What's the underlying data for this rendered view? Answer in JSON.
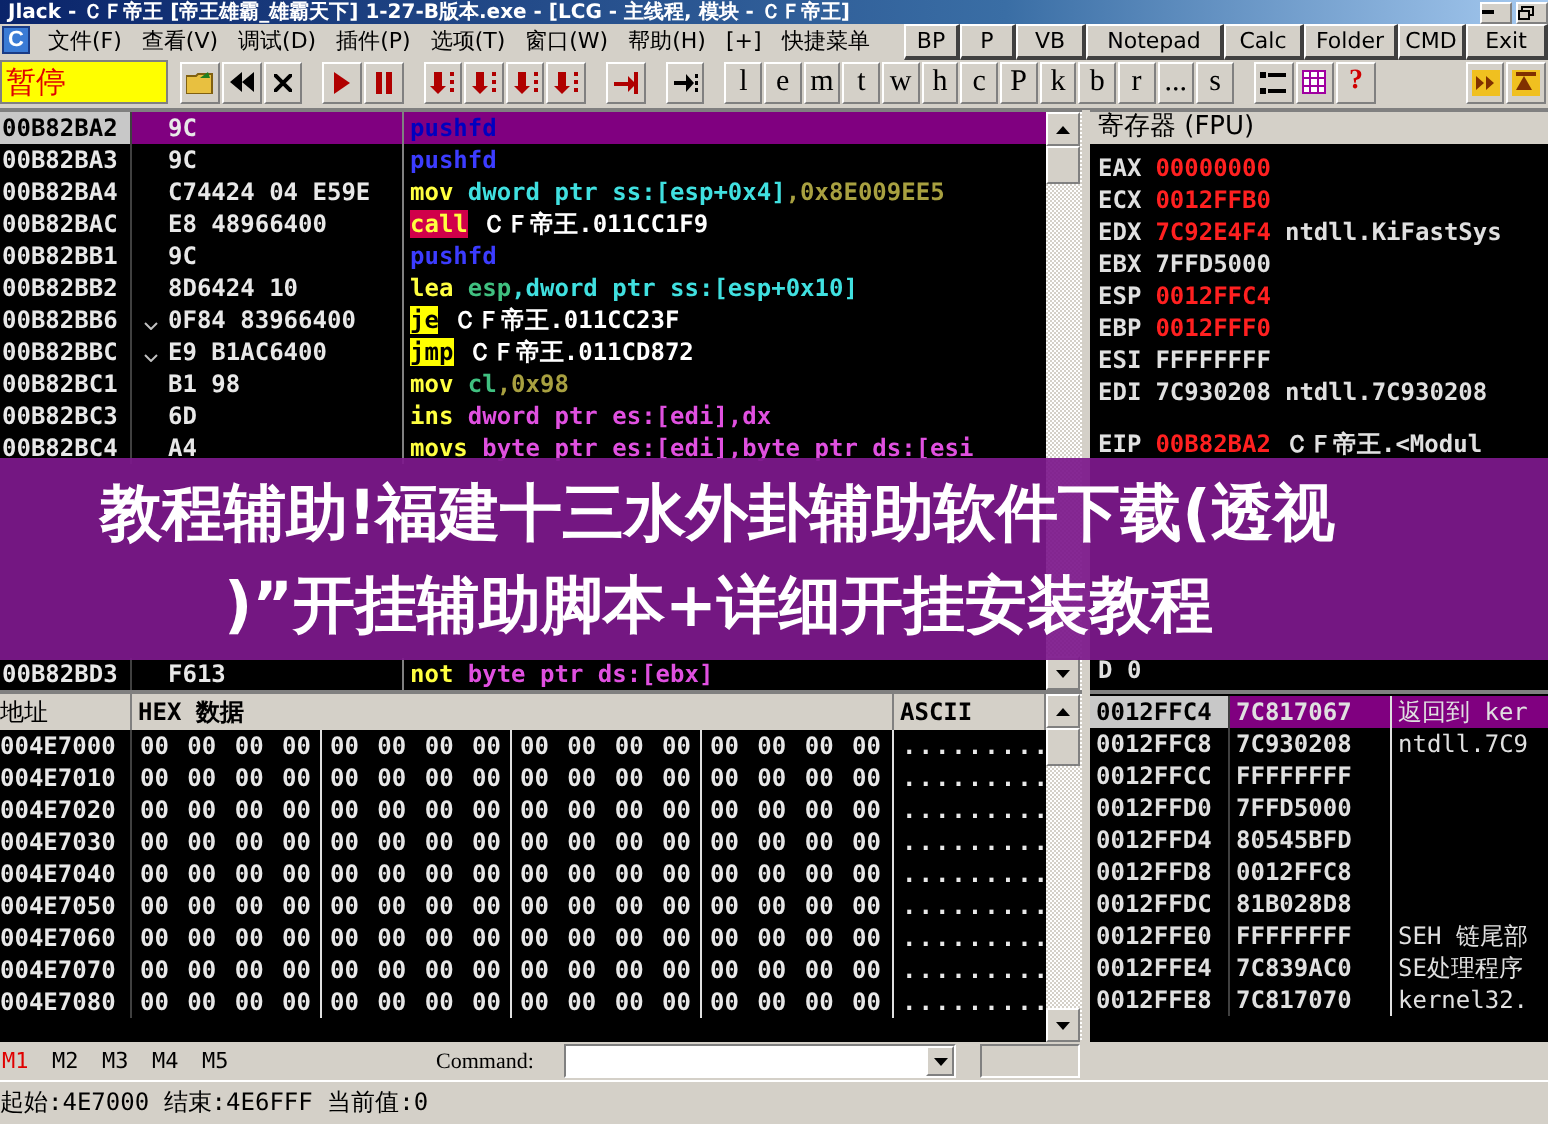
{
  "window": {
    "title": "Jlack - ＣＦ帝王 [帝王雄霸_雄霸天下] 1-27-B版本.exe - [LCG - 主线程, 模块 - ＣＦ帝王]"
  },
  "menu": {
    "icon_letter": "C",
    "items": [
      "文件(F)",
      "查看(V)",
      "调试(D)",
      "插件(P)",
      "选项(T)",
      "窗口(W)",
      "帮助(H)",
      "[+]",
      "快捷菜单"
    ]
  },
  "toolbar": {
    "status": "暂停",
    "letters": [
      "l",
      "e",
      "m",
      "t",
      "w",
      "h",
      "c",
      "P",
      "k",
      "b",
      "r",
      "...",
      "s"
    ],
    "help_glyph": "?"
  },
  "quick_launch": [
    "BP",
    "P",
    "VB",
    "Notepad",
    "Calc",
    "Folder",
    "CMD",
    "Exit"
  ],
  "disassembly": {
    "rows": [
      {
        "address": "00B82BA2",
        "hex": "9C",
        "jump": false,
        "selected": true,
        "mnemonic": "pushfd",
        "kind": "push",
        "operands": []
      },
      {
        "address": "00B82BA3",
        "hex": "9C",
        "jump": false,
        "selected": false,
        "mnemonic": "pushfd",
        "kind": "push",
        "operands": []
      },
      {
        "address": "00B82BA4",
        "hex": "C74424 04 E59E",
        "jump": false,
        "selected": false,
        "mnemonic": "mov",
        "kind": "plain",
        "operands": [
          {
            "text": "dword ptr ss:[esp+0x4]",
            "kind": "stack"
          },
          {
            "text": ",0x8E009EE5",
            "kind": "imm"
          }
        ]
      },
      {
        "address": "00B82BAC",
        "hex": "E8 48966400",
        "jump": false,
        "selected": false,
        "mnemonic": "call",
        "kind": "call",
        "operands": [
          {
            "text": "ＣＦ帝王.011CC1F9",
            "kind": "sym"
          }
        ]
      },
      {
        "address": "00B82BB1",
        "hex": "9C",
        "jump": false,
        "selected": false,
        "mnemonic": "pushfd",
        "kind": "push",
        "operands": []
      },
      {
        "address": "00B82BB2",
        "hex": "8D6424 10",
        "jump": false,
        "selected": false,
        "mnemonic": "lea",
        "kind": "plain",
        "operands": [
          {
            "text": "esp",
            "kind": "reg"
          },
          {
            "text": ",dword ptr ss:[esp+0x10]",
            "kind": "stack"
          }
        ]
      },
      {
        "address": "00B82BB6",
        "hex": "0F84 83966400",
        "jump": true,
        "selected": false,
        "mnemonic": "je",
        "kind": "jump",
        "operands": [
          {
            "text": "ＣＦ帝王.011CC23F",
            "kind": "sym"
          }
        ]
      },
      {
        "address": "00B82BBC",
        "hex": "E9 B1AC6400",
        "jump": true,
        "selected": false,
        "mnemonic": "jmp",
        "kind": "jump",
        "operands": [
          {
            "text": "ＣＦ帝王.011CD872",
            "kind": "sym"
          }
        ]
      },
      {
        "address": "00B82BC1",
        "hex": "B1 98",
        "jump": false,
        "selected": false,
        "mnemonic": "mov",
        "kind": "plain",
        "operands": [
          {
            "text": "cl",
            "kind": "reg"
          },
          {
            "text": ",0x98",
            "kind": "imm"
          }
        ]
      },
      {
        "address": "00B82BC3",
        "hex": "6D",
        "jump": false,
        "selected": false,
        "mnemonic": "ins",
        "kind": "plain",
        "operands": [
          {
            "text": "dword ptr es:[edi],dx",
            "kind": "mem"
          }
        ]
      },
      {
        "address": "00B82BC4",
        "hex": "A4",
        "jump": false,
        "selected": false,
        "mnemonic": "movs",
        "kind": "plain",
        "operands": [
          {
            "text": "byte ptr es:[edi],byte ptr ds:[esi",
            "kind": "mem"
          }
        ]
      },
      {
        "address": "00B82BD3",
        "hex": "F613",
        "jump": false,
        "selected": false,
        "mnemonic": "not",
        "kind": "plain",
        "operands": [
          {
            "text": "byte ptr ds:[ebx]",
            "kind": "mem"
          }
        ]
      }
    ]
  },
  "registers": {
    "title": "寄存器 (FPU)",
    "general": [
      {
        "name": "EAX",
        "value": "00000000",
        "changed": true
      },
      {
        "name": "ECX",
        "value": "0012FFB0",
        "changed": true
      },
      {
        "name": "EDX",
        "value": "7C92E4F4",
        "changed": true,
        "comment": "ntdll.KiFastSys"
      },
      {
        "name": "EBX",
        "value": "7FFD5000",
        "changed": false
      },
      {
        "name": "ESP",
        "value": "0012FFC4",
        "changed": true
      },
      {
        "name": "EBP",
        "value": "0012FFF0",
        "changed": true
      },
      {
        "name": "ESI",
        "value": "FFFFFFFF",
        "changed": false
      },
      {
        "name": "EDI",
        "value": "7C930208",
        "changed": false,
        "comment": "ntdll.7C930208"
      }
    ],
    "eip": {
      "name": "EIP",
      "value": "00B82BA2",
      "changed": true,
      "comment": "ＣＦ帝王.<Modul"
    },
    "flags": [
      "D 0"
    ]
  },
  "dump": {
    "columns": [
      "地址",
      "HEX 数据",
      "ASCII"
    ],
    "rows": [
      {
        "address": "004E7000",
        "bytes": [
          "00 00 00 00",
          "00 00 00 00",
          "00 00 00 00",
          "00 00 00 00"
        ],
        "ascii": "........."
      },
      {
        "address": "004E7010",
        "bytes": [
          "00 00 00 00",
          "00 00 00 00",
          "00 00 00 00",
          "00 00 00 00"
        ],
        "ascii": "........."
      },
      {
        "address": "004E7020",
        "bytes": [
          "00 00 00 00",
          "00 00 00 00",
          "00 00 00 00",
          "00 00 00 00"
        ],
        "ascii": "........."
      },
      {
        "address": "004E7030",
        "bytes": [
          "00 00 00 00",
          "00 00 00 00",
          "00 00 00 00",
          "00 00 00 00"
        ],
        "ascii": "........."
      },
      {
        "address": "004E7040",
        "bytes": [
          "00 00 00 00",
          "00 00 00 00",
          "00 00 00 00",
          "00 00 00 00"
        ],
        "ascii": "........."
      },
      {
        "address": "004E7050",
        "bytes": [
          "00 00 00 00",
          "00 00 00 00",
          "00 00 00 00",
          "00 00 00 00"
        ],
        "ascii": "........."
      },
      {
        "address": "004E7060",
        "bytes": [
          "00 00 00 00",
          "00 00 00 00",
          "00 00 00 00",
          "00 00 00 00"
        ],
        "ascii": "........."
      },
      {
        "address": "004E7070",
        "bytes": [
          "00 00 00 00",
          "00 00 00 00",
          "00 00 00 00",
          "00 00 00 00"
        ],
        "ascii": "........."
      },
      {
        "address": "004E7080",
        "bytes": [
          "00 00 00 00",
          "00 00 00 00",
          "00 00 00 00",
          "00 00 00 00"
        ],
        "ascii": "........."
      }
    ]
  },
  "stack": {
    "rows": [
      {
        "address": "0012FFC4",
        "value": "7C817067",
        "comment": "返回到 ker",
        "selected": true
      },
      {
        "address": "0012FFC8",
        "value": "7C930208",
        "comment": "ntdll.7C9",
        "selected": false
      },
      {
        "address": "0012FFCC",
        "value": "FFFFFFFF",
        "selected": false
      },
      {
        "address": "0012FFD0",
        "value": "7FFD5000",
        "selected": false
      },
      {
        "address": "0012FFD4",
        "value": "80545BFD",
        "selected": false
      },
      {
        "address": "0012FFD8",
        "value": "0012FFC8",
        "selected": false
      },
      {
        "address": "0012FFDC",
        "value": "81B028D8",
        "selected": false
      },
      {
        "address": "0012FFE0",
        "value": "FFFFFFFF",
        "comment": "SEH 链尾部",
        "selected": false
      },
      {
        "address": "0012FFE4",
        "value": "7C839AC0",
        "comment": "SE处理程序",
        "selected": false
      },
      {
        "address": "0012FFE8",
        "value": "7C817070",
        "comment": "kernel32.",
        "selected": false
      }
    ]
  },
  "command_bar": {
    "markers": [
      {
        "label": "M1",
        "selected": true
      },
      {
        "label": "M2",
        "selected": false
      },
      {
        "label": "M3",
        "selected": false
      },
      {
        "label": "M4",
        "selected": false
      },
      {
        "label": "M5",
        "selected": false
      }
    ],
    "label": "Command:"
  },
  "status_bar": "起始:4E7000 结束:4E6FFF 当前值:0",
  "overlay_caption": [
    "教程辅助!福建十三水外卦辅助软件下载(透视",
    ")”开挂辅助脚本+详细开挂安装教程"
  ]
}
